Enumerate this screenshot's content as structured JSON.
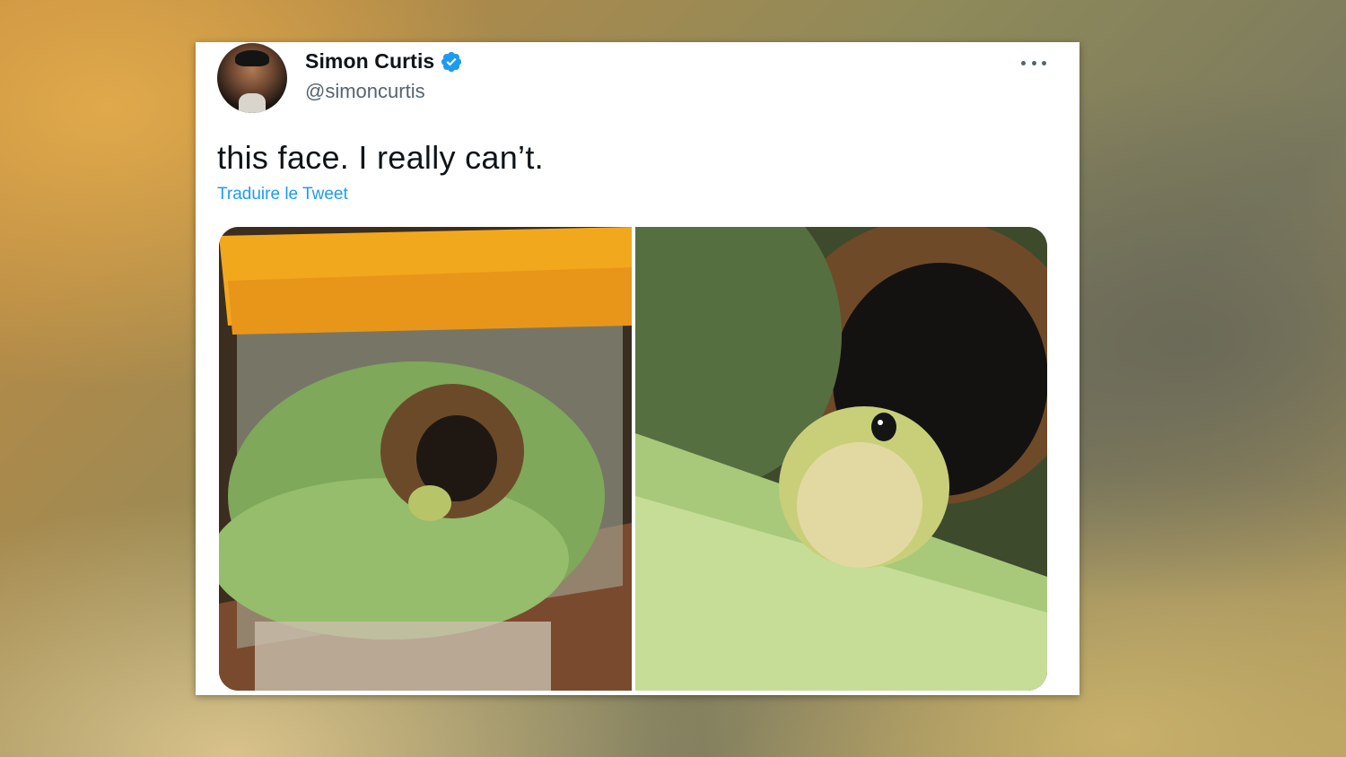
{
  "tweet": {
    "author_name": "Simon Curtis",
    "author_handle": "@simoncurtis",
    "verified": true,
    "text": "this face. I really can’t.",
    "translate_label": "Traduire le Tweet",
    "photos": [
      {
        "description_icon": "frog-in-terrarium-photo"
      },
      {
        "description_icon": "frog-closeup-photo"
      }
    ]
  },
  "colors": {
    "link_blue": "#1d9bf0",
    "verified_blue": "#1d9bf0",
    "text_primary": "#0f1419",
    "text_secondary": "#536471"
  }
}
